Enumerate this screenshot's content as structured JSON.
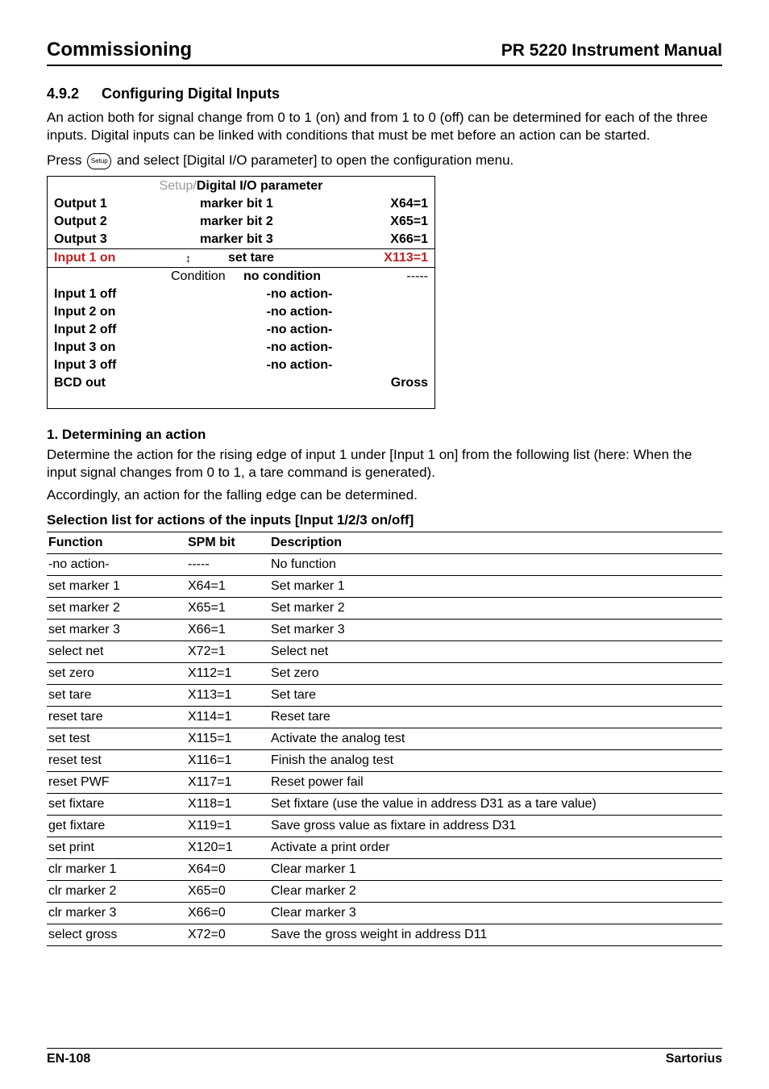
{
  "header": {
    "left": "Commissioning",
    "right": "PR 5220 Instrument Manual"
  },
  "section": {
    "number": "4.9.2",
    "title": "Configuring Digital Inputs",
    "intro": "An action both for signal change from 0 to 1 (on) and from 1 to 0 (off) can be determined for each of the three inputs. Digital inputs can be linked with conditions that must be met before an action can be started.",
    "press_before": "Press ",
    "press_after": " and select [Digital I/O parameter] to open the configuration menu.",
    "setup_icon_text": "Setup"
  },
  "setup": {
    "breadcrumb_gray": "Setup/",
    "breadcrumb_bold": "Digital I/O parameter",
    "rows": {
      "out1": {
        "label": "Output 1",
        "center": "marker bit 1",
        "right": "X64=1"
      },
      "out2": {
        "label": "Output 2",
        "center": "marker bit 2",
        "right": "X65=1"
      },
      "out3": {
        "label": "Output 3",
        "center": "marker bit 3",
        "right": "X66=1"
      },
      "in1on": {
        "label": "Input 1 on",
        "center": "set tare",
        "right": "X113=1"
      },
      "cond": {
        "cond_label": "Condition",
        "center": "no condition",
        "right": "-----"
      },
      "in1off": {
        "label": "Input 1 off",
        "center": "-no action-"
      },
      "in2on": {
        "label": "Input 2 on",
        "center": "-no action-"
      },
      "in2off": {
        "label": "Input 2 off",
        "center": "-no action-"
      },
      "in3on": {
        "label": "Input 3 on",
        "center": "-no action-"
      },
      "in3off": {
        "label": "Input 3 off",
        "center": "-no action-"
      },
      "bcd": {
        "label": "BCD out",
        "right": "Gross"
      }
    }
  },
  "determine": {
    "heading": "1. Determining an action",
    "p1": "Determine the action for the rising edge of input 1 under [Input 1 on] from the following list (here: When the input signal changes from 0 to 1, a tare command is generated).",
    "p2": "Accordingly, an action for the falling edge can be determined."
  },
  "selection_heading": "Selection list for actions of the inputs [Input 1/2/3 on/off]",
  "table": {
    "headers": {
      "c1": "Function",
      "c2": "SPM bit",
      "c3": "Description"
    },
    "rows": [
      {
        "f": "-no action-",
        "s": "-----",
        "d": "No function"
      },
      {
        "f": "set marker 1",
        "s": "X64=1",
        "d": "Set marker 1"
      },
      {
        "f": "set marker 2",
        "s": "X65=1",
        "d": "Set marker 2"
      },
      {
        "f": "set marker 3",
        "s": "X66=1",
        "d": "Set marker 3"
      },
      {
        "f": "select net",
        "s": "X72=1",
        "d": "Select net"
      },
      {
        "f": "set zero",
        "s": "X112=1",
        "d": "Set zero"
      },
      {
        "f": "set tare",
        "s": "X113=1",
        "d": "Set tare"
      },
      {
        "f": "reset tare",
        "s": "X114=1",
        "d": "Reset tare"
      },
      {
        "f": "set test",
        "s": "X115=1",
        "d": "Activate the analog test"
      },
      {
        "f": "reset test",
        "s": "X116=1",
        "d": "Finish the analog test"
      },
      {
        "f": "reset PWF",
        "s": "X117=1",
        "d": "Reset power fail"
      },
      {
        "f": "set fixtare",
        "s": "X118=1",
        "d": "Set fixtare (use the value in address D31 as a tare value)"
      },
      {
        "f": "get fixtare",
        "s": "X119=1",
        "d": "Save gross value as fixtare in address D31"
      },
      {
        "f": "set print",
        "s": "X120=1",
        "d": "Activate a print order"
      },
      {
        "f": "clr marker 1",
        "s": "X64=0",
        "d": "Clear marker 1"
      },
      {
        "f": "clr marker 2",
        "s": "X65=0",
        "d": "Clear marker 2"
      },
      {
        "f": "clr marker 3",
        "s": "X66=0",
        "d": "Clear marker 3"
      },
      {
        "f": "select gross",
        "s": "X72=0",
        "d": "Save the gross weight in address D11"
      }
    ]
  },
  "footer": {
    "left": "EN-108",
    "right": "Sartorius"
  }
}
